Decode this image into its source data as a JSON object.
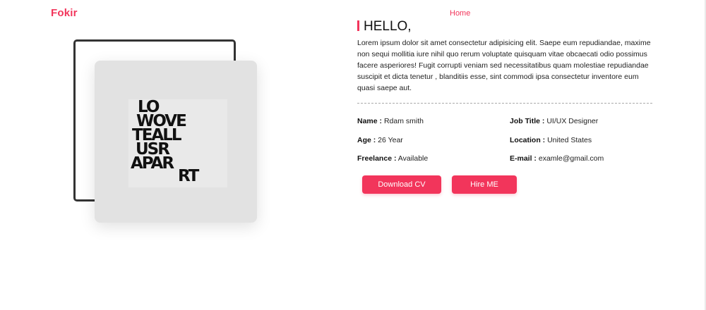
{
  "header": {
    "logo": "Fokir",
    "nav_home": "Home"
  },
  "photo": {
    "art_lines": [
      "LO",
      "WOVE",
      "TEALL",
      "USR",
      "APAR",
      "RT"
    ]
  },
  "about": {
    "greeting": "HELLO,",
    "intro": "Lorem ipsum dolor sit amet consectetur adipisicing elit. Saepe eum repudiandae, maxime non sequi mollitia iure nihil quo rerum voluptate quisquam vitae obcaecati odio possimus facere asperiores! Fugit corrupti veniam sed necessitatibus quam molestiae repudiandae suscipit et dicta tenetur , blanditiis esse, sint commodi ipsa consectetur inventore eum quasi saepe aut."
  },
  "info": {
    "name_label": "Name :",
    "name_value": "Rdam smith",
    "job_label": "Job Title :",
    "job_value": "UI/UX Designer",
    "age_label": "Age :",
    "age_value": "26 Year",
    "location_label": "Location :",
    "location_value": "United States",
    "freelance_label": "Freelance :",
    "freelance_value": "Available",
    "email_label": "E-mail :",
    "email_value": "examle@gmail.com"
  },
  "buttons": {
    "download_cv": "Download CV",
    "hire_me": "Hire ME"
  },
  "colors": {
    "accent": "#f2355b"
  }
}
